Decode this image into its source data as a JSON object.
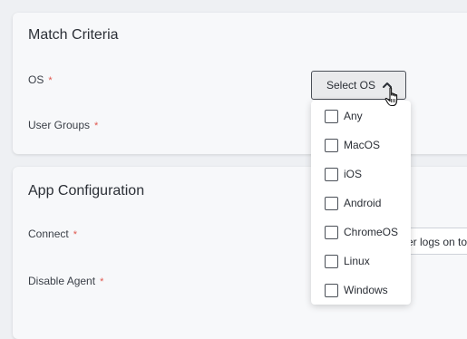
{
  "match_criteria": {
    "title": "Match Criteria",
    "os_label": "OS",
    "user_groups_label": "User Groups",
    "required_mark": "*",
    "os_select": {
      "label": "Select OS",
      "icon": "chevron-up-icon",
      "expanded": true,
      "options": [
        {
          "label": "Any",
          "checked": false
        },
        {
          "label": "MacOS",
          "checked": false
        },
        {
          "label": "iOS",
          "checked": false
        },
        {
          "label": "Android",
          "checked": false
        },
        {
          "label": "ChromeOS",
          "checked": false
        },
        {
          "label": "Linux",
          "checked": false
        },
        {
          "label": "Windows",
          "checked": false
        }
      ]
    }
  },
  "app_configuration": {
    "title": "App Configuration",
    "connect_label": "Connect",
    "disable_agent_label": "Disable Agent",
    "required_mark": "*",
    "connect_value_visible": "er logs on to"
  },
  "cursor": "hand-pointer-icon",
  "colors": {
    "required": "#e0584f",
    "card_bg": "#f7f8fa",
    "page_bg": "#eef0f3"
  }
}
